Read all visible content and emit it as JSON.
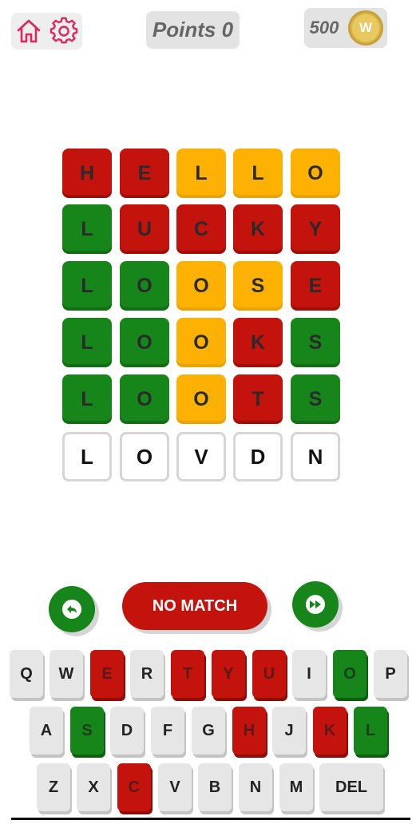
{
  "header": {
    "home_icon": "home-icon",
    "settings_icon": "gear-icon",
    "points_label": "Points 0",
    "coins": "500",
    "coin_letter": "W"
  },
  "colors": {
    "red": "#c4120c",
    "green": "#17861a",
    "orange": "#fdb203",
    "accent_pink": "#e0245e"
  },
  "grid": [
    [
      {
        "l": "H",
        "c": "red"
      },
      {
        "l": "E",
        "c": "red"
      },
      {
        "l": "L",
        "c": "orange"
      },
      {
        "l": "L",
        "c": "orange"
      },
      {
        "l": "O",
        "c": "orange"
      }
    ],
    [
      {
        "l": "L",
        "c": "green"
      },
      {
        "l": "U",
        "c": "red"
      },
      {
        "l": "C",
        "c": "red"
      },
      {
        "l": "K",
        "c": "red"
      },
      {
        "l": "Y",
        "c": "red"
      }
    ],
    [
      {
        "l": "L",
        "c": "green"
      },
      {
        "l": "O",
        "c": "green"
      },
      {
        "l": "O",
        "c": "orange"
      },
      {
        "l": "S",
        "c": "orange"
      },
      {
        "l": "E",
        "c": "red"
      }
    ],
    [
      {
        "l": "L",
        "c": "green"
      },
      {
        "l": "O",
        "c": "green"
      },
      {
        "l": "O",
        "c": "orange"
      },
      {
        "l": "K",
        "c": "red"
      },
      {
        "l": "S",
        "c": "green"
      }
    ],
    [
      {
        "l": "L",
        "c": "green"
      },
      {
        "l": "O",
        "c": "green"
      },
      {
        "l": "O",
        "c": "orange"
      },
      {
        "l": "T",
        "c": "red"
      },
      {
        "l": "S",
        "c": "green"
      }
    ],
    [
      {
        "l": "L",
        "c": "empty"
      },
      {
        "l": "O",
        "c": "empty"
      },
      {
        "l": "V",
        "c": "empty"
      },
      {
        "l": "D",
        "c": "empty"
      },
      {
        "l": "N",
        "c": "empty"
      }
    ]
  ],
  "controls": {
    "back_icon": "undo-icon",
    "status_label": "NO MATCH",
    "skip_icon": "fast-forward-icon"
  },
  "keyboard": [
    [
      {
        "k": "Q",
        "c": "default"
      },
      {
        "k": "W",
        "c": "default"
      },
      {
        "k": "E",
        "c": "red"
      },
      {
        "k": "R",
        "c": "default"
      },
      {
        "k": "T",
        "c": "red"
      },
      {
        "k": "Y",
        "c": "red"
      },
      {
        "k": "U",
        "c": "red"
      },
      {
        "k": "I",
        "c": "default"
      },
      {
        "k": "O",
        "c": "green"
      },
      {
        "k": "P",
        "c": "default"
      }
    ],
    [
      {
        "k": "A",
        "c": "default"
      },
      {
        "k": "S",
        "c": "green"
      },
      {
        "k": "D",
        "c": "default"
      },
      {
        "k": "F",
        "c": "default"
      },
      {
        "k": "G",
        "c": "default"
      },
      {
        "k": "H",
        "c": "red"
      },
      {
        "k": "J",
        "c": "default"
      },
      {
        "k": "K",
        "c": "red"
      },
      {
        "k": "L",
        "c": "green"
      }
    ],
    [
      {
        "k": "Z",
        "c": "default"
      },
      {
        "k": "X",
        "c": "default"
      },
      {
        "k": "C",
        "c": "red"
      },
      {
        "k": "V",
        "c": "default"
      },
      {
        "k": "B",
        "c": "default"
      },
      {
        "k": "N",
        "c": "default"
      },
      {
        "k": "M",
        "c": "default"
      },
      {
        "k": "DEL",
        "c": "default"
      }
    ]
  ]
}
